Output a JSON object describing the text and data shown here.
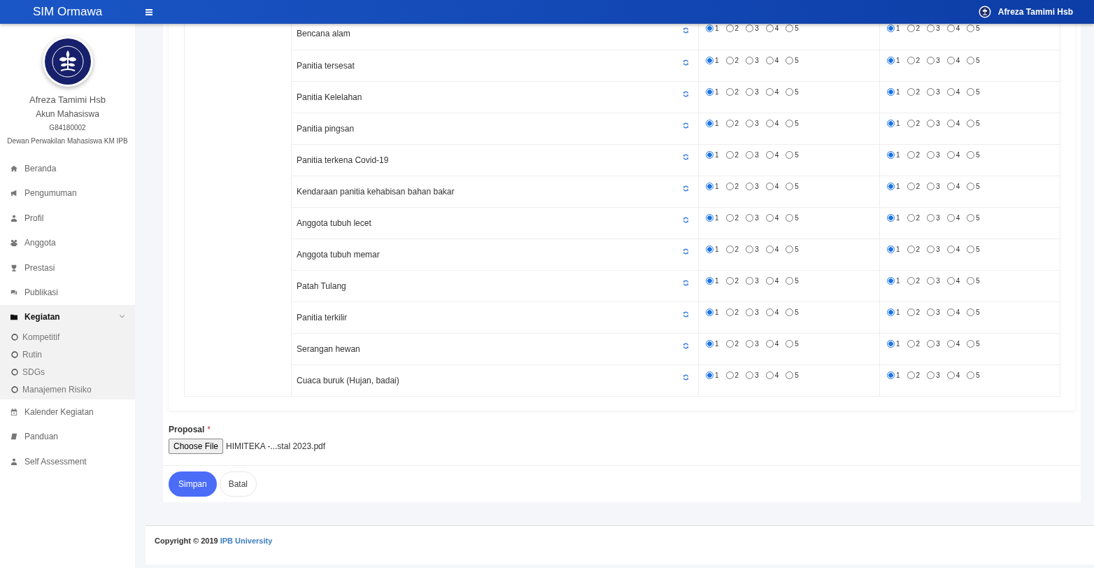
{
  "navbar": {
    "brand": "SIM Ormawa",
    "user": "Afreza Tamimi Hsb"
  },
  "sidebar": {
    "profile": {
      "name": "Afreza Tamimi Hsb",
      "role": "Akun Mahasiswa",
      "nim": "G84180002",
      "organization": "Dewan Perwakilan Mahasiswa KM IPB"
    },
    "items": [
      {
        "kind": "link",
        "label": "Beranda"
      },
      {
        "kind": "link",
        "label": "Pengumuman"
      },
      {
        "kind": "link",
        "label": "Profil"
      },
      {
        "kind": "link",
        "label": "Anggota"
      },
      {
        "kind": "link",
        "label": "Prestasi"
      },
      {
        "kind": "link",
        "label": "Publikasi"
      },
      {
        "kind": "group",
        "label": "Kegiatan",
        "expanded": true,
        "children": [
          {
            "label": "Kompetitif"
          },
          {
            "label": "Rutin"
          },
          {
            "label": "SDGs"
          },
          {
            "label": "Manajemen Risiko"
          }
        ]
      },
      {
        "kind": "link",
        "label": "Kalender Kegiatan"
      },
      {
        "kind": "link",
        "label": "Panduan"
      },
      {
        "kind": "link",
        "label": "Self Assessment"
      }
    ]
  },
  "risk_table": {
    "rows": [
      {
        "risk": "Bencana alam",
        "ratings": [
          {
            "options": [
              {
                "label": "1",
                "selected": true
              },
              {
                "label": "2",
                "selected": false
              },
              {
                "label": "3",
                "selected": false
              },
              {
                "label": "4",
                "selected": false
              },
              {
                "label": "5",
                "selected": false
              }
            ]
          },
          {
            "options": [
              {
                "label": "1",
                "selected": true
              },
              {
                "label": "2",
                "selected": false
              },
              {
                "label": "3",
                "selected": false
              },
              {
                "label": "4",
                "selected": false
              },
              {
                "label": "5",
                "selected": false
              }
            ]
          }
        ]
      },
      {
        "risk": "Panitia tersesat",
        "ratings": [
          {
            "options": [
              {
                "label": "1",
                "selected": true
              },
              {
                "label": "2",
                "selected": false
              },
              {
                "label": "3",
                "selected": false
              },
              {
                "label": "4",
                "selected": false
              },
              {
                "label": "5",
                "selected": false
              }
            ]
          },
          {
            "options": [
              {
                "label": "1",
                "selected": true
              },
              {
                "label": "2",
                "selected": false
              },
              {
                "label": "3",
                "selected": false
              },
              {
                "label": "4",
                "selected": false
              },
              {
                "label": "5",
                "selected": false
              }
            ]
          }
        ]
      },
      {
        "risk": "Panitia Kelelahan",
        "ratings": [
          {
            "options": [
              {
                "label": "1",
                "selected": true
              },
              {
                "label": "2",
                "selected": false
              },
              {
                "label": "3",
                "selected": false
              },
              {
                "label": "4",
                "selected": false
              },
              {
                "label": "5",
                "selected": false
              }
            ]
          },
          {
            "options": [
              {
                "label": "1",
                "selected": true
              },
              {
                "label": "2",
                "selected": false
              },
              {
                "label": "3",
                "selected": false
              },
              {
                "label": "4",
                "selected": false
              },
              {
                "label": "5",
                "selected": false
              }
            ]
          }
        ]
      },
      {
        "risk": "Panitia pingsan",
        "ratings": [
          {
            "options": [
              {
                "label": "1",
                "selected": true
              },
              {
                "label": "2",
                "selected": false
              },
              {
                "label": "3",
                "selected": false
              },
              {
                "label": "4",
                "selected": false
              },
              {
                "label": "5",
                "selected": false
              }
            ]
          },
          {
            "options": [
              {
                "label": "1",
                "selected": true
              },
              {
                "label": "2",
                "selected": false
              },
              {
                "label": "3",
                "selected": false
              },
              {
                "label": "4",
                "selected": false
              },
              {
                "label": "5",
                "selected": false
              }
            ]
          }
        ]
      },
      {
        "risk": "Panitia terkena Covid-19",
        "ratings": [
          {
            "options": [
              {
                "label": "1",
                "selected": true
              },
              {
                "label": "2",
                "selected": false
              },
              {
                "label": "3",
                "selected": false
              },
              {
                "label": "4",
                "selected": false
              },
              {
                "label": "5",
                "selected": false
              }
            ]
          },
          {
            "options": [
              {
                "label": "1",
                "selected": true
              },
              {
                "label": "2",
                "selected": false
              },
              {
                "label": "3",
                "selected": false
              },
              {
                "label": "4",
                "selected": false
              },
              {
                "label": "5",
                "selected": false
              }
            ]
          }
        ]
      },
      {
        "risk": "Kendaraan panitia kehabisan bahan bakar",
        "ratings": [
          {
            "options": [
              {
                "label": "1",
                "selected": true
              },
              {
                "label": "2",
                "selected": false
              },
              {
                "label": "3",
                "selected": false
              },
              {
                "label": "4",
                "selected": false
              },
              {
                "label": "5",
                "selected": false
              }
            ]
          },
          {
            "options": [
              {
                "label": "1",
                "selected": true
              },
              {
                "label": "2",
                "selected": false
              },
              {
                "label": "3",
                "selected": false
              },
              {
                "label": "4",
                "selected": false
              },
              {
                "label": "5",
                "selected": false
              }
            ]
          }
        ]
      },
      {
        "risk": "Anggota tubuh lecet",
        "ratings": [
          {
            "options": [
              {
                "label": "1",
                "selected": true
              },
              {
                "label": "2",
                "selected": false
              },
              {
                "label": "3",
                "selected": false
              },
              {
                "label": "4",
                "selected": false
              },
              {
                "label": "5",
                "selected": false
              }
            ]
          },
          {
            "options": [
              {
                "label": "1",
                "selected": true
              },
              {
                "label": "2",
                "selected": false
              },
              {
                "label": "3",
                "selected": false
              },
              {
                "label": "4",
                "selected": false
              },
              {
                "label": "5",
                "selected": false
              }
            ]
          }
        ]
      },
      {
        "risk": "Anggota tubuh memar",
        "ratings": [
          {
            "options": [
              {
                "label": "1",
                "selected": true
              },
              {
                "label": "2",
                "selected": false
              },
              {
                "label": "3",
                "selected": false
              },
              {
                "label": "4",
                "selected": false
              },
              {
                "label": "5",
                "selected": false
              }
            ]
          },
          {
            "options": [
              {
                "label": "1",
                "selected": true
              },
              {
                "label": "2",
                "selected": false
              },
              {
                "label": "3",
                "selected": false
              },
              {
                "label": "4",
                "selected": false
              },
              {
                "label": "5",
                "selected": false
              }
            ]
          }
        ]
      },
      {
        "risk": "Patah Tulang",
        "ratings": [
          {
            "options": [
              {
                "label": "1",
                "selected": true
              },
              {
                "label": "2",
                "selected": false
              },
              {
                "label": "3",
                "selected": false
              },
              {
                "label": "4",
                "selected": false
              },
              {
                "label": "5",
                "selected": false
              }
            ]
          },
          {
            "options": [
              {
                "label": "1",
                "selected": true
              },
              {
                "label": "2",
                "selected": false
              },
              {
                "label": "3",
                "selected": false
              },
              {
                "label": "4",
                "selected": false
              },
              {
                "label": "5",
                "selected": false
              }
            ]
          }
        ]
      },
      {
        "risk": "Panitia terkilir",
        "ratings": [
          {
            "options": [
              {
                "label": "1",
                "selected": true
              },
              {
                "label": "2",
                "selected": false
              },
              {
                "label": "3",
                "selected": false
              },
              {
                "label": "4",
                "selected": false
              },
              {
                "label": "5",
                "selected": false
              }
            ]
          },
          {
            "options": [
              {
                "label": "1",
                "selected": true
              },
              {
                "label": "2",
                "selected": false
              },
              {
                "label": "3",
                "selected": false
              },
              {
                "label": "4",
                "selected": false
              },
              {
                "label": "5",
                "selected": false
              }
            ]
          }
        ]
      },
      {
        "risk": "Serangan hewan",
        "ratings": [
          {
            "options": [
              {
                "label": "1",
                "selected": true
              },
              {
                "label": "2",
                "selected": false
              },
              {
                "label": "3",
                "selected": false
              },
              {
                "label": "4",
                "selected": false
              },
              {
                "label": "5",
                "selected": false
              }
            ]
          },
          {
            "options": [
              {
                "label": "1",
                "selected": true
              },
              {
                "label": "2",
                "selected": false
              },
              {
                "label": "3",
                "selected": false
              },
              {
                "label": "4",
                "selected": false
              },
              {
                "label": "5",
                "selected": false
              }
            ]
          }
        ]
      },
      {
        "risk": "Cuaca buruk (Hujan, badai)",
        "ratings": [
          {
            "options": [
              {
                "label": "1",
                "selected": true
              },
              {
                "label": "2",
                "selected": false
              },
              {
                "label": "3",
                "selected": false
              },
              {
                "label": "4",
                "selected": false
              },
              {
                "label": "5",
                "selected": false
              }
            ]
          },
          {
            "options": [
              {
                "label": "1",
                "selected": true
              },
              {
                "label": "2",
                "selected": false
              },
              {
                "label": "3",
                "selected": false
              },
              {
                "label": "4",
                "selected": false
              },
              {
                "label": "5",
                "selected": false
              }
            ]
          }
        ]
      }
    ]
  },
  "proposal": {
    "label": "Proposal",
    "required_mark": "*",
    "button": "Choose File",
    "filename": "HIMITEKA -...stal 2023.pdf"
  },
  "buttons": [
    {
      "kind": "primary",
      "label": "Simpan"
    },
    {
      "kind": "secondary",
      "label": "Batal"
    }
  ],
  "footer": {
    "text": "Copyright © 2019",
    "link": "IPB University"
  }
}
